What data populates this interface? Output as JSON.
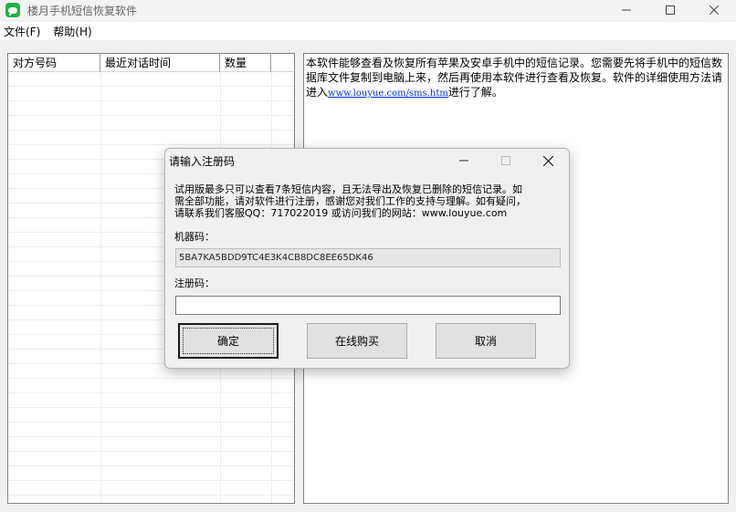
{
  "window": {
    "title": "楼月手机短信恢复软件",
    "icon": "chat-bubble-icon",
    "controls": {
      "minimize": "minimize-icon",
      "maximize": "maximize-icon",
      "close": "close-icon"
    }
  },
  "menu": [
    {
      "label": "文件(F)"
    },
    {
      "label": "帮助(H)"
    }
  ],
  "list": {
    "columns": [
      "对方号码",
      "最近对话时间",
      "数量"
    ]
  },
  "info": {
    "text_before_link": "本软件能够查看及恢复所有苹果及安卓手机中的短信记录。您需要先将手机中的短信数据库文件复制到电脑上来，然后再使用本软件进行查看及恢复。软件的详细使用方法请进入",
    "link": "www.louyue.com/sms.htm",
    "text_after_link": "进行了解。"
  },
  "dialog": {
    "title": "请输入注册码",
    "message_line1": "试用版最多只可以查看7条短信内容，且无法导出及恢复已删除的短信记录。如",
    "message_line2": "需全部功能，请对软件进行注册，感谢您对我们工作的支持与理解。如有疑问，",
    "message_line3": "请联系我们客服QQ：717022019 或访问我们的网站：www.louyue.com",
    "machine_code_label": "机器码：",
    "machine_code_value": "5BA7KA5BDD9TC4E3K4CB8DC8EE65DK46",
    "reg_code_label": "注册码：",
    "reg_code_value": "",
    "buttons": {
      "ok": "确定",
      "buy": "在线购买",
      "cancel": "取消"
    }
  },
  "colors": {
    "app_icon": "#22b14c",
    "link": "#0033cc",
    "background": "#f0f0f0"
  }
}
